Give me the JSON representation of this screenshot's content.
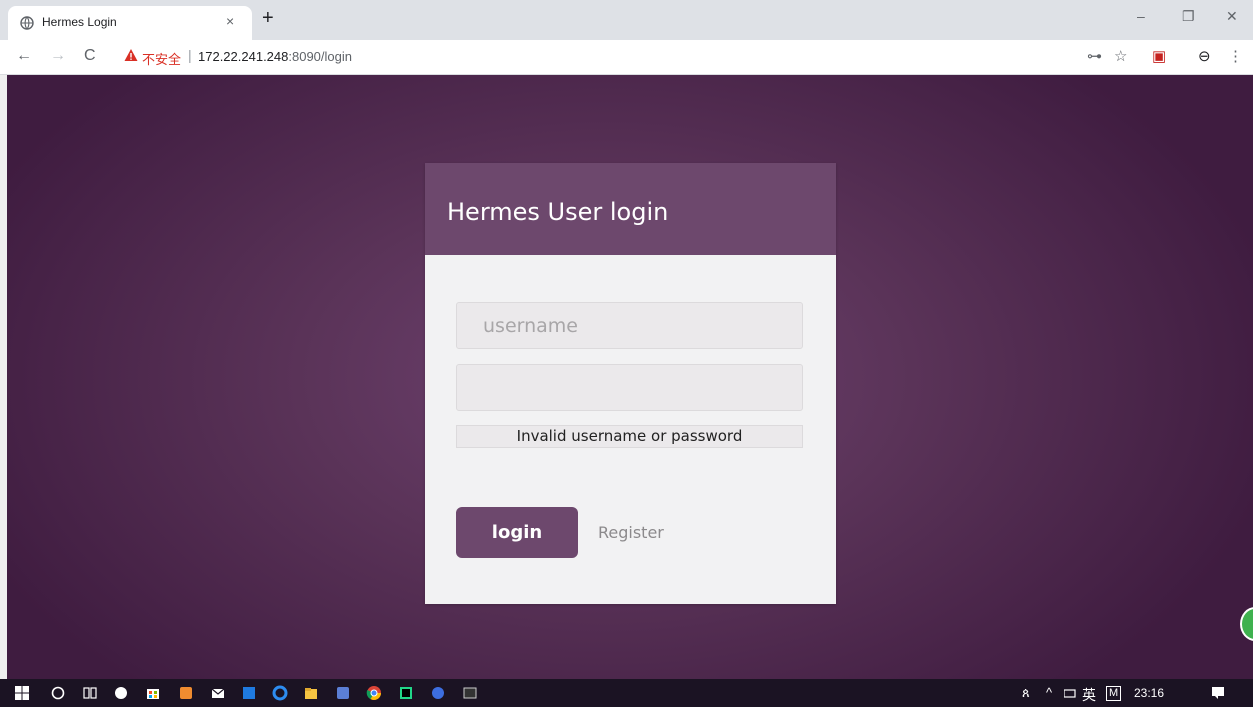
{
  "browser": {
    "tab_title": "Hermes Login",
    "tab_close": "×",
    "new_tab": "+",
    "window_controls": {
      "minimize": "–",
      "restore": "❐",
      "close": "✕"
    },
    "nav": {
      "back": "←",
      "forward": "→",
      "reload": "C"
    },
    "security_label": "不安全",
    "separator": "|",
    "url_host": "172.22.241.248",
    "url_rest": ":8090/login",
    "toolbar_icons": {
      "key": "⊶",
      "star": "☆",
      "ext": "▣",
      "account": "⊖",
      "menu": "⋮"
    }
  },
  "login": {
    "title": "Hermes User login",
    "username_placeholder": "username",
    "username_value": "",
    "password_value": "",
    "error_message": "Invalid username or password",
    "login_button": "login",
    "register_link": "Register"
  },
  "colors": {
    "brand": "#6d486d",
    "background": "#5a3358",
    "card": "#f2f2f3",
    "warning": "#d93025"
  },
  "taskbar": {
    "time": "23:16",
    "ime_label": "英",
    "ime_mode": "M",
    "tray_chevron": "^"
  }
}
